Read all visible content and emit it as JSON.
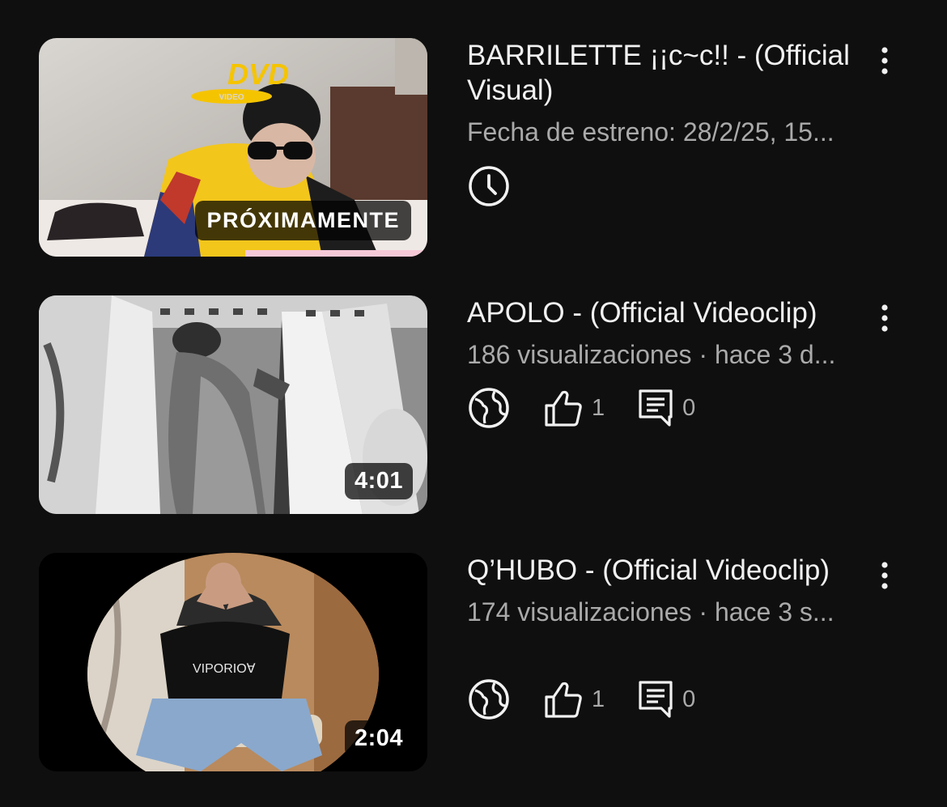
{
  "videos": [
    {
      "title": "BARRILETTE ¡¡c~c!! - (Official Visual)",
      "meta": "Fecha de estreno: 28/2/25, 15...",
      "badge": "PRÓXIMAMENTE",
      "thumbnail_logo": "DVD",
      "thumbnail_logo_sub": "VIDEO",
      "status_icon": "clock-icon"
    },
    {
      "title": "APOLO - (Official Videoclip)",
      "meta": "186 visualizaciones · hace 3 d...",
      "badge": "4:01",
      "visibility_icon": "globe-icon",
      "likes": "1",
      "comments": "0"
    },
    {
      "title": "Q’HUBO - (Official Videoclip)",
      "meta": "174 visualizaciones · hace 3 s...",
      "badge": "2:04",
      "visibility_icon": "globe-icon",
      "likes": "1",
      "comments": "0"
    }
  ],
  "colors": {
    "background": "#0f0f0f",
    "title": "#f1f1f1",
    "meta": "#aaaaaa",
    "logo_yellow": "#f5c400"
  }
}
